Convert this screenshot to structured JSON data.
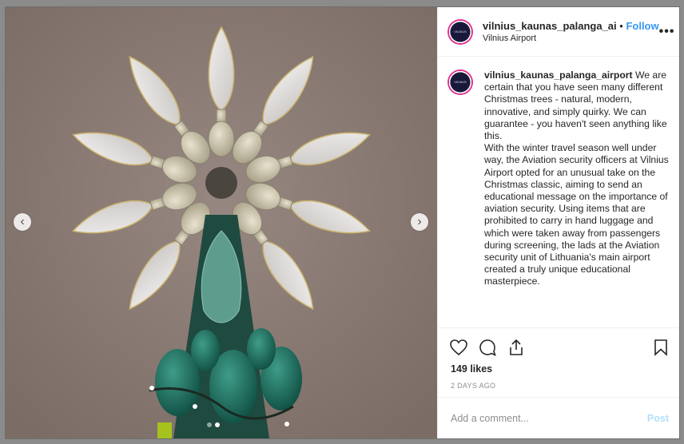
{
  "post": {
    "username": "vilnius_kaunas_palanga_ai",
    "separator": "•",
    "follow_label": "Follow",
    "location": "Vilnius Airport",
    "more_label": "•••"
  },
  "caption": {
    "username": "vilnius_kaunas_palanga_airport",
    "text": " We are certain that you have seen many different Christmas trees - natural, modern, innovative, and simply quirky. We can guarantee - you haven't seen anything like this.",
    "text2": "With the winter travel season well under way, the Aviation security officers at Vilnius Airport opted for an unusual take on the Christmas classic, aiming to send an educational message on the importance of aviation security. Using items that are prohibited to carry in hand luggage and which were taken away from passengers during screening, the lads at the Aviation security unit of Lithuania's main airport created a truly unique educational masterpiece."
  },
  "avatar_text": "VILNIUS AIRPORT",
  "stats": {
    "likes": "149 likes",
    "time": "2 DAYS AGO"
  },
  "comment": {
    "placeholder": "Add a comment...",
    "post_label": "Post"
  },
  "carousel": {
    "prev_label": "‹",
    "next_label": "›",
    "total_slides": 2,
    "active_slide": 2
  },
  "icons": {
    "like": "heart-icon",
    "comment": "comment-icon",
    "share": "share-icon",
    "save": "bookmark-icon"
  },
  "colors": {
    "follow": "#3897f0",
    "post_disabled": "#b2dffc",
    "muted": "#8e8e8e"
  }
}
